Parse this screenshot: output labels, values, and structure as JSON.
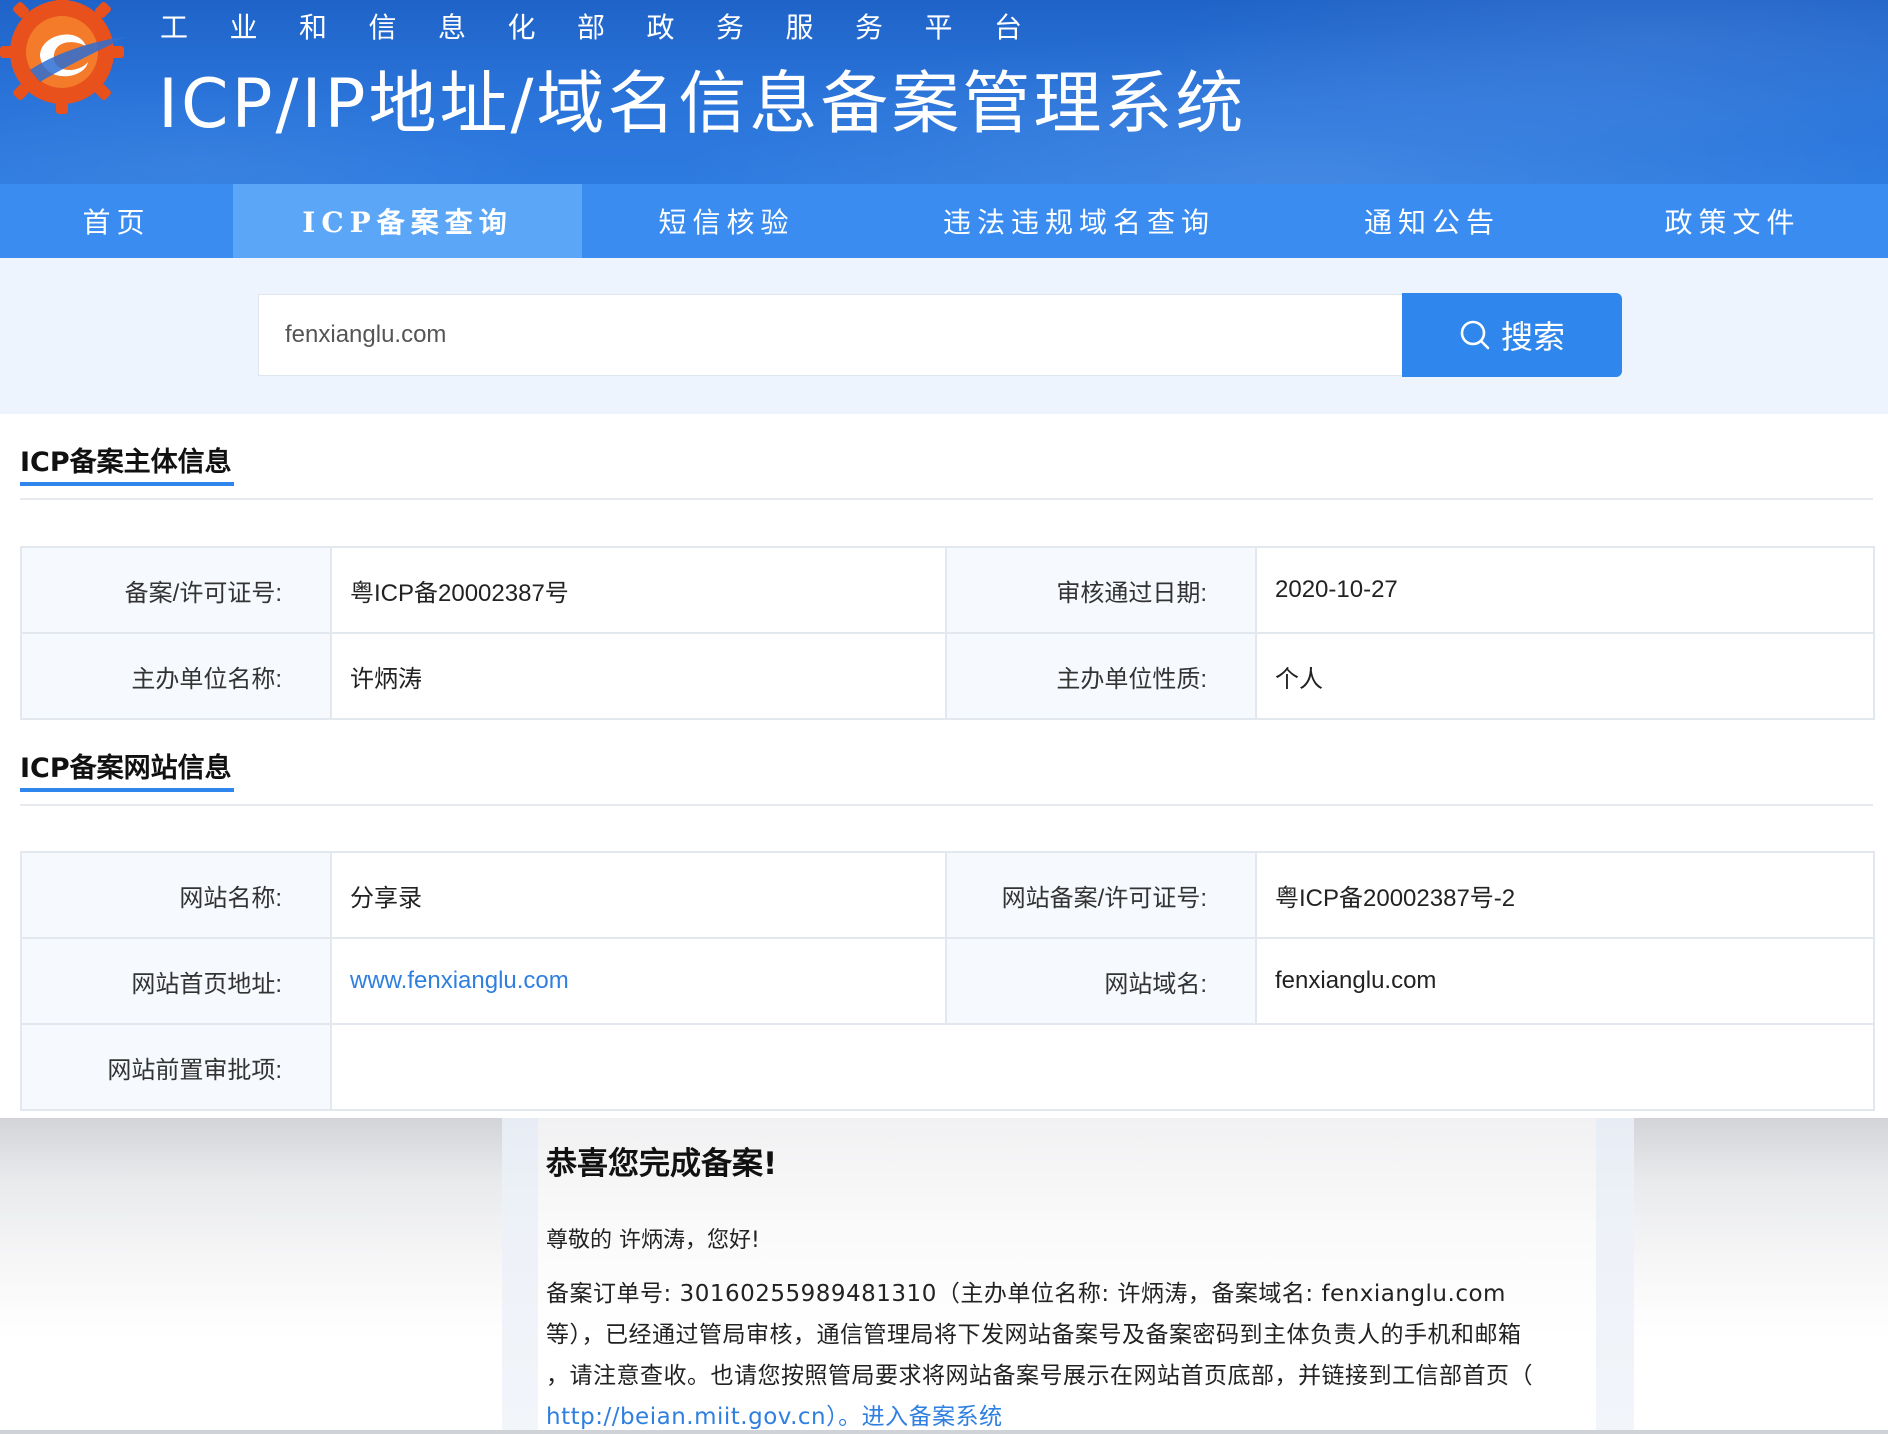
{
  "header": {
    "org_name": "工业和信息化部政务服务平台",
    "system_title": "ICP/IP地址/域名信息备案管理系统"
  },
  "nav": {
    "items": [
      {
        "label": "首页"
      },
      {
        "label": "ICP备案查询",
        "active": true
      },
      {
        "label": "短信核验"
      },
      {
        "label": "违法违规域名查询"
      },
      {
        "label": "通知公告"
      },
      {
        "label": "政策文件"
      }
    ]
  },
  "search": {
    "value": "fenxianglu.com",
    "button_label": "搜索",
    "button_icon": "search-icon"
  },
  "subject_info": {
    "title": "ICP备案主体信息",
    "rows": [
      [
        {
          "label": "备案/许可证号:",
          "value": "粤ICP备20002387号"
        },
        {
          "label": "审核通过日期:",
          "value": "2020-10-27"
        }
      ],
      [
        {
          "label": "主办单位名称:",
          "value": "许炳涛"
        },
        {
          "label": "主办单位性质:",
          "value": "个人"
        }
      ]
    ]
  },
  "website_info": {
    "title": "ICP备案网站信息",
    "rows": [
      [
        {
          "label": "网站名称:",
          "value": "分享录"
        },
        {
          "label": "网站备案/许可证号:",
          "value": "粤ICP备20002387号-2"
        }
      ],
      [
        {
          "label": "网站首页地址:",
          "value": "www.fenxianglu.com"
        },
        {
          "label": "网站域名:",
          "value": "fenxianglu.com"
        }
      ],
      [
        {
          "label": "网站前置审批项:",
          "value": ""
        }
      ]
    ]
  },
  "email": {
    "title": "恭喜您完成备案!",
    "greeting": "尊敬的 许炳涛，您好!",
    "line1": "备案订单号: 30160255989481310（主办单位名称: 许炳涛，备案域名: fenxianglu.com",
    "line2": "等），已经通过管局审核，通信管理局将下发网站备案号及备案密码到主体负责人的手机和邮箱",
    "line3": "，请注意查收。也请您按照管局要求将网站备案号展示在网站首页底部，并链接到工信部首页（",
    "line4_prefix": "http://beian.miit.gov.cn）。",
    "line4_link": "进入备案系统"
  },
  "colors": {
    "header_blue": "#1f63c8",
    "nav_blue": "#3a8cf0",
    "nav_active": "#5ba6f6",
    "accent": "#2f86ec",
    "link": "#2f7fe0"
  }
}
